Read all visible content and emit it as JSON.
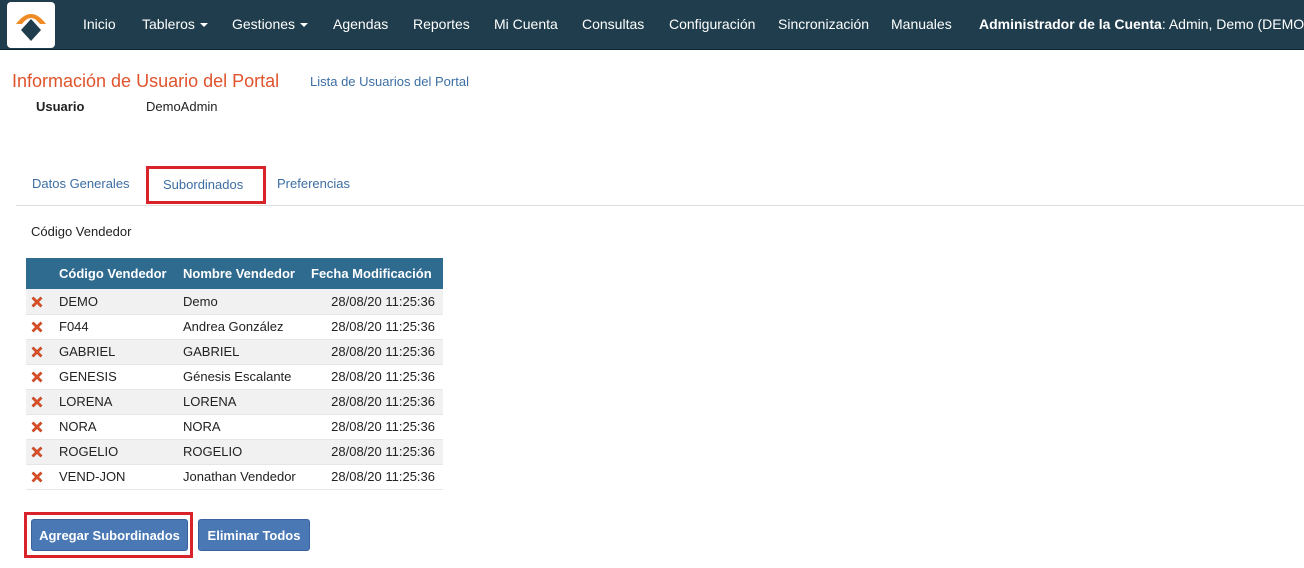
{
  "nav": {
    "items": [
      {
        "label": "Inicio",
        "dropdown": false
      },
      {
        "label": "Tableros",
        "dropdown": true
      },
      {
        "label": "Gestiones",
        "dropdown": true
      },
      {
        "label": "Agendas",
        "dropdown": false
      },
      {
        "label": "Reportes",
        "dropdown": false
      },
      {
        "label": "Mi Cuenta",
        "dropdown": false
      },
      {
        "label": "Consultas",
        "dropdown": false
      },
      {
        "label": "Configuración",
        "dropdown": false
      },
      {
        "label": "Sincronización",
        "dropdown": false
      },
      {
        "label": "Manuales",
        "dropdown": false
      }
    ],
    "account_role": "Administrador de la Cuenta",
    "account_user": ": Admin, Demo (DEMO)"
  },
  "header": {
    "title": "Información de Usuario del Portal",
    "portal_list_link": "Lista de Usuarios del Portal",
    "user_label": "Usuario",
    "user_value": "DemoAdmin"
  },
  "tabs": [
    {
      "label": "Datos Generales",
      "active": false
    },
    {
      "label": "Subordinados",
      "active": true
    },
    {
      "label": "Preferencias",
      "active": false
    }
  ],
  "subordinados": {
    "section_label": "Código Vendedor",
    "columns": [
      "Código Vendedor",
      "Nombre Vendedor",
      "Fecha Modificación"
    ],
    "rows": [
      {
        "codigo": "DEMO",
        "nombre": "Demo",
        "fecha": "28/08/20 11:25:36"
      },
      {
        "codigo": "F044",
        "nombre": "Andrea González",
        "fecha": "28/08/20 11:25:36"
      },
      {
        "codigo": "GABRIEL",
        "nombre": "GABRIEL",
        "fecha": "28/08/20 11:25:36"
      },
      {
        "codigo": "GENESIS",
        "nombre": "Génesis Escalante",
        "fecha": "28/08/20 11:25:36"
      },
      {
        "codigo": "LORENA",
        "nombre": "LORENA",
        "fecha": "28/08/20 11:25:36"
      },
      {
        "codigo": "NORA",
        "nombre": "NORA",
        "fecha": "28/08/20 11:25:36"
      },
      {
        "codigo": "ROGELIO",
        "nombre": "ROGELIO",
        "fecha": "28/08/20 11:25:36"
      },
      {
        "codigo": "VEND-JON",
        "nombre": "Jonathan Vendedor",
        "fecha": "28/08/20 11:25:36"
      }
    ],
    "row_icon": "delete-x-icon"
  },
  "buttons": {
    "add_label": "Agregar Subordinados",
    "delete_all_label": "Eliminar Todos"
  },
  "colors": {
    "navbar": "#1f3d4c",
    "title": "#e0532b",
    "link": "#3c6ea3",
    "table_header": "#2f6a8f",
    "button": "#4a78b5",
    "highlight": "#d8232a",
    "delete_icon": "#e0532b"
  }
}
